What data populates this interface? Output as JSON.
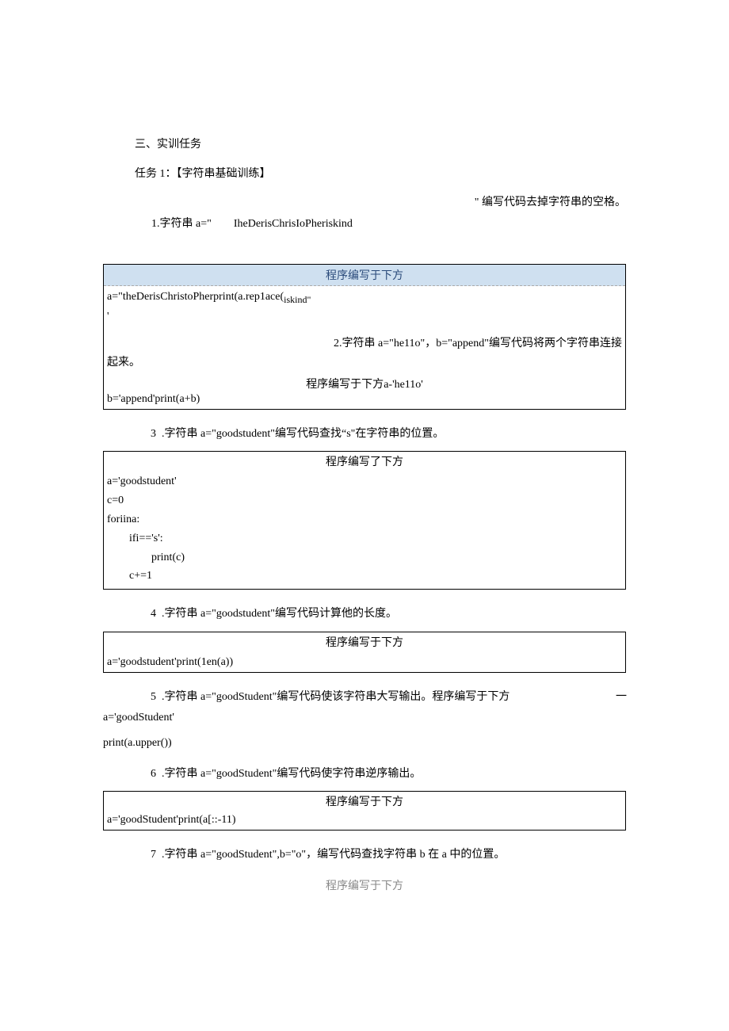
{
  "heading": "三、实训任务",
  "task_title": "任务 1：【字符串基础训练】",
  "q1": {
    "prefix": "1.字符串 a=\"",
    "code_inline": "IheDerisChrisIoPheriskind",
    "suffix": "\" 编写代码去掉字符串的空格。",
    "box_header": "程序编写于下方",
    "code_line": "a=\"theDerisChristoPherprint(a.rep1ace(",
    "sub": " iskind\"",
    "trailing_quote": "'"
  },
  "q2": {
    "text_right": "2.字符串 a=\"he11o\"，b=\"append\"编写代码将两个字符串连接",
    "text_left_cont": "起来。",
    "inner_header": "程序编写于下方",
    "inner_header_after": " a-'he11o'",
    "code_footer": "b='append'print(a+b)"
  },
  "q3": {
    "num": "3",
    "text": ".字符串 a=\"goodstudent\"编写代码查找“s\"在字符串的位置。",
    "box_header": "程序编写了下方",
    "code": "a='goodstudent'\nc=0\nforiina:\n        ifi=='s':\n                print(c)\n        c+=1"
  },
  "q4": {
    "num": "4",
    "text": ".字符串 a=\"goodstudent\"编写代码计算他的长度。",
    "box_header": "程序编写于下方",
    "code": "a='goodstudent'print(1en(a))"
  },
  "q5": {
    "num": "5",
    "text": ".字符串 a=\"goodStudent\"编写代码使该字符串大写输出。程序编写于下方",
    "dash": "一",
    "code1": "a='goodStudent'",
    "code2": "print(a.upper())"
  },
  "q6": {
    "num": "6",
    "text": ".字符串 a=\"goodStudent\"编写代码使字符串逆序输出。",
    "box_header": "程序编写于下方",
    "code": "a='goodStudent'print(a[::-11)"
  },
  "q7": {
    "num": "7",
    "text": ".字符串 a=\"goodStudent\",b=\"o\"，编写代码查找字符串 b 在 a 中的位置。",
    "footer_header": "程序编写于下方"
  }
}
